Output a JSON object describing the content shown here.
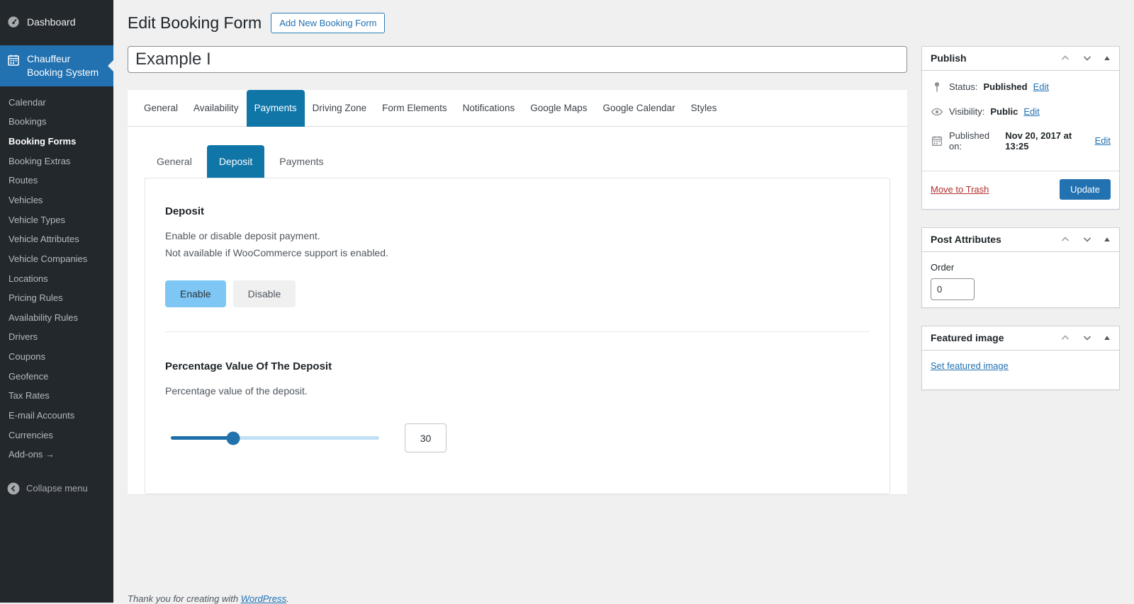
{
  "sidebar": {
    "dashboard_label": "Dashboard",
    "plugin_label": "Chauffeur Booking System",
    "items": [
      {
        "label": "Calendar",
        "active": false
      },
      {
        "label": "Bookings",
        "active": false
      },
      {
        "label": "Booking Forms",
        "active": true
      },
      {
        "label": "Booking Extras",
        "active": false
      },
      {
        "label": "Routes",
        "active": false
      },
      {
        "label": "Vehicles",
        "active": false
      },
      {
        "label": "Vehicle Types",
        "active": false
      },
      {
        "label": "Vehicle Attributes",
        "active": false
      },
      {
        "label": "Vehicle Companies",
        "active": false
      },
      {
        "label": "Locations",
        "active": false
      },
      {
        "label": "Pricing Rules",
        "active": false
      },
      {
        "label": "Availability Rules",
        "active": false
      },
      {
        "label": "Drivers",
        "active": false
      },
      {
        "label": "Coupons",
        "active": false
      },
      {
        "label": "Geofence",
        "active": false
      },
      {
        "label": "Tax Rates",
        "active": false
      },
      {
        "label": "E-mail Accounts",
        "active": false
      },
      {
        "label": "Currencies",
        "active": false
      },
      {
        "label": "Add-ons →",
        "active": false
      }
    ],
    "collapse_label": "Collapse menu"
  },
  "header": {
    "title": "Edit Booking Form",
    "add_new_label": "Add New Booking Form"
  },
  "title_field": {
    "value": "Example I"
  },
  "main": {
    "tabs": [
      {
        "label": "General",
        "active": false
      },
      {
        "label": "Availability",
        "active": false
      },
      {
        "label": "Payments",
        "active": true
      },
      {
        "label": "Driving Zone",
        "active": false
      },
      {
        "label": "Form Elements",
        "active": false
      },
      {
        "label": "Notifications",
        "active": false
      },
      {
        "label": "Google Maps",
        "active": false
      },
      {
        "label": "Google Calendar",
        "active": false
      },
      {
        "label": "Styles",
        "active": false
      }
    ],
    "subtabs": [
      {
        "label": "General",
        "active": false
      },
      {
        "label": "Deposit",
        "active": true
      },
      {
        "label": "Payments",
        "active": false
      }
    ],
    "deposit": {
      "heading": "Deposit",
      "desc1": "Enable or disable deposit payment.",
      "desc2": "Not available if WooCommerce support is enabled.",
      "enable_label": "Enable",
      "disable_label": "Disable",
      "enabled": true
    },
    "percentage": {
      "heading": "Percentage Value Of The Deposit",
      "desc": "Percentage value of the deposit.",
      "value": "30",
      "slider_percent": 30
    }
  },
  "publish": {
    "title": "Publish",
    "status_label": "Status:",
    "status_value": "Published",
    "visibility_label": "Visibility:",
    "visibility_value": "Public",
    "published_label": "Published on:",
    "published_value": "Nov 20, 2017 at 13:25",
    "edit_label": "Edit",
    "trash_label": "Move to Trash",
    "update_label": "Update",
    "icons": [
      "pin-icon",
      "eye-icon",
      "calendar-icon"
    ]
  },
  "post_attributes": {
    "title": "Post Attributes",
    "order_label": "Order",
    "order_value": "0"
  },
  "featured_image": {
    "title": "Featured image",
    "link_label": "Set featured image"
  },
  "footer": {
    "text": "Thank you for creating with ",
    "link": "WordPress",
    "suffix": "."
  },
  "colors": {
    "page_bg": "#f0f0f1",
    "sidebar_bg": "#23282d",
    "sidebar_active": "#2271b1",
    "tab_active": "#1076a8",
    "accent_link": "#2271b1",
    "enable_button": "#7ec7f5",
    "slider_fill": "#1d6fa9",
    "slider_track": "#c2e0f5",
    "trash_red": "#b32d2e"
  }
}
